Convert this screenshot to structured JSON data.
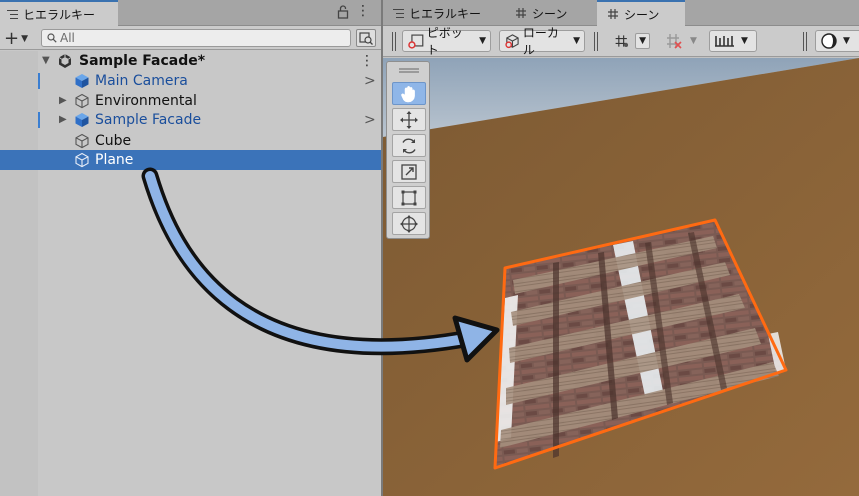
{
  "hierarchy": {
    "tab_label": "ヒエラルキー",
    "search_placeholder": "All",
    "scene_name": "Sample Facade*",
    "items": [
      {
        "label": "Main Camera",
        "prefab": true
      },
      {
        "label": "Environmental",
        "prefab": false
      },
      {
        "label": "Sample Facade",
        "prefab": true
      },
      {
        "label": "Cube",
        "prefab": false
      },
      {
        "label": "Plane",
        "prefab": false,
        "selected": true
      }
    ]
  },
  "scene_tabs": [
    {
      "label": "ヒエラルキー",
      "active": false
    },
    {
      "label": "シーン",
      "active": false
    },
    {
      "label": "シーン",
      "active": true
    }
  ],
  "scene_toolbar": {
    "pivot_label": "ピボット",
    "space_label": "ローカル"
  },
  "colors": {
    "selection": "#3b73b9",
    "prefab_text": "#1a4e9c",
    "ground": "#8a6437",
    "sky": "#9fb1c4",
    "outline": "#ff6a12",
    "arrow_fill": "#8fb4e6"
  },
  "icons": {
    "hand_tool": "hand-icon",
    "move_tool": "move-icon",
    "rotate_tool": "rotate-icon",
    "scale_tool": "scale-icon",
    "rect_tool": "rect-icon",
    "transform_tool": "transform-icon"
  }
}
